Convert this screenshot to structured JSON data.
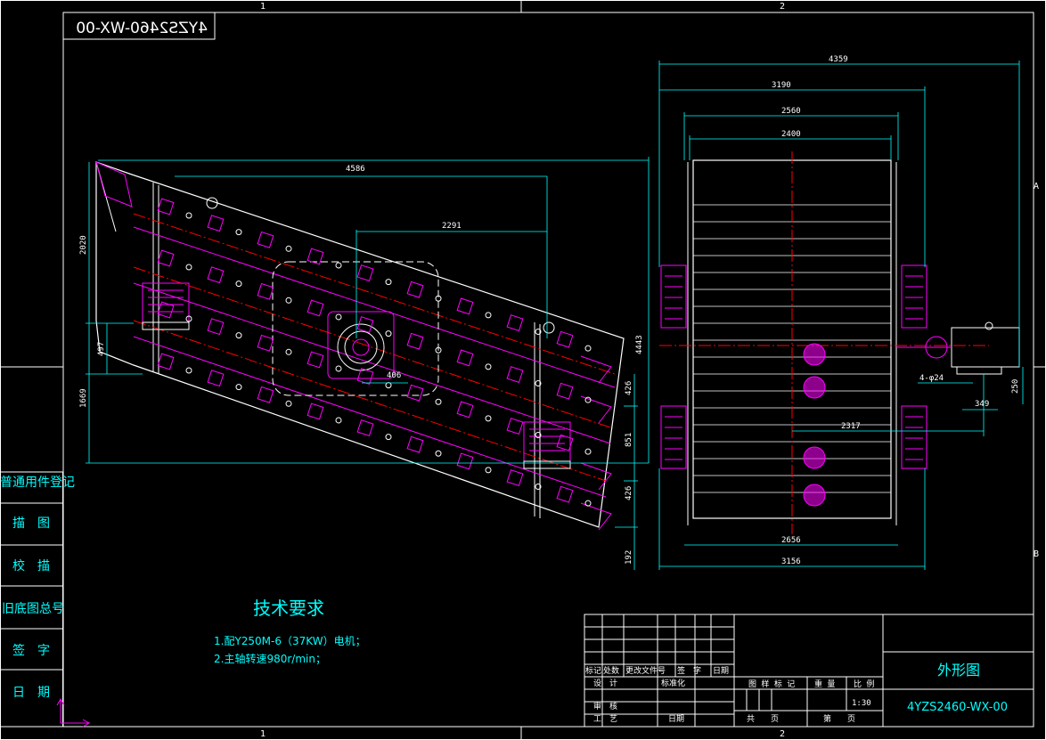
{
  "drawing_number": "4YZS2460-WX-00",
  "zone_labels": {
    "top_left": "1",
    "top_right": "2",
    "bottom_left": "1",
    "bottom_right": "2",
    "right_a": "A",
    "right_b": "B"
  },
  "side_column": [
    "普通用件登记",
    "描　图",
    "校　描",
    "旧底图总号",
    "签　字",
    "日　期"
  ],
  "left_view_dims": {
    "d4586": "4586",
    "d2291": "2291",
    "d2020": "2020",
    "d497": "497",
    "d1669": "1669",
    "d4443": "4443",
    "d406": "406",
    "d426a": "426",
    "d851": "851",
    "d426b": "426",
    "d192": "192"
  },
  "right_view_dims": {
    "d4359": "4359",
    "d3190": "3190",
    "d2560": "2560",
    "d2400": "2400",
    "d2317": "2317",
    "d2656": "2656",
    "d3156": "3156",
    "d250": "250",
    "d4phi24": "4-φ24",
    "d349": "349"
  },
  "notes": {
    "title": "技术要求",
    "line1": "1.配Y250M-6（37KW）电机；",
    "line2": "2.主轴转速980r/min；"
  },
  "title_block": {
    "drawing_name": "外形图",
    "code": "4YZS2460-WX-00",
    "scale_value": "1:30",
    "row_headers": [
      "标记",
      "处数",
      "更改文件号",
      "签　字",
      "日期"
    ],
    "design": "设　计",
    "standardize": "标准化",
    "review": "审　核",
    "process": "工　艺",
    "date": "日期",
    "stage_mark": "图 样 标 记",
    "weight": "重 量",
    "scale": "比 例",
    "total": "共　　页",
    "sheet": "第　　页"
  },
  "colors": {
    "background": "#000000",
    "frame": "#ffffff",
    "dimension": "#00ffff",
    "center_line": "#ff0000",
    "parts": "#ff00ff",
    "hatch": "#ff00ff"
  }
}
